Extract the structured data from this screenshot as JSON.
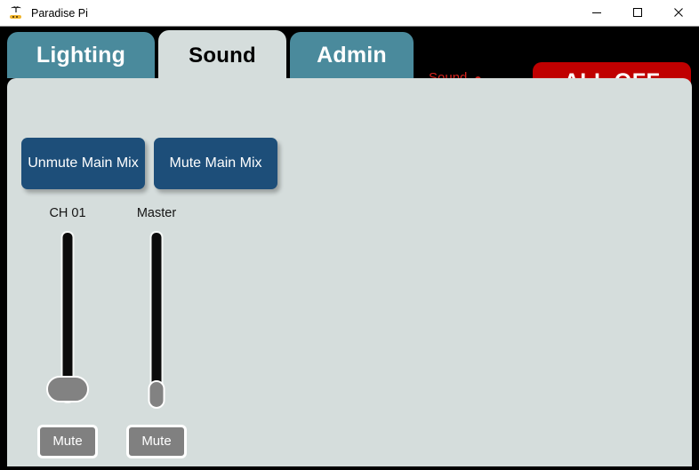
{
  "window": {
    "title": "Paradise Pi",
    "icon": "palm-tree-icon",
    "controls": {
      "minimize": "minimize-icon",
      "maximize": "maximize-icon",
      "close": "close-icon"
    }
  },
  "tabs": [
    {
      "label": "Lighting",
      "active": false
    },
    {
      "label": "Sound",
      "active": true
    },
    {
      "label": "Admin",
      "active": false
    }
  ],
  "header": {
    "status_text": "Sound",
    "status_dot": "status-indicator-dot",
    "all_off_label": "ALL OFF"
  },
  "main": {
    "mix_buttons": [
      {
        "label": "Unmute Main Mix"
      },
      {
        "label": "Mute Main Mix"
      }
    ],
    "channels": [
      {
        "label": "CH 01",
        "fader_position": "bottom",
        "mute_label": "Mute"
      },
      {
        "label": "Master",
        "fader_position": "bottom",
        "mute_label": "Mute"
      }
    ]
  },
  "colors": {
    "tab_inactive": "#4a8a9c",
    "tab_active": "#d5dddc",
    "panel_background": "#d5dddc",
    "mix_button": "#1d4e79",
    "all_off": "#c00000",
    "status_text": "#d9241f",
    "mute_button": "#808080",
    "window_chrome": "#000000"
  }
}
